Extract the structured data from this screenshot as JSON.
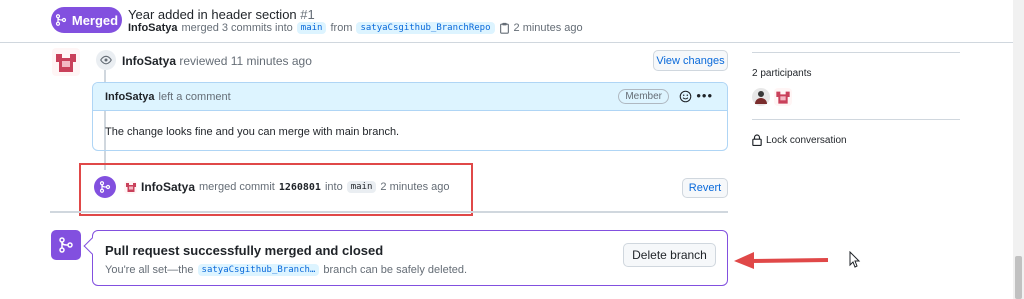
{
  "header": {
    "status_badge": "Merged",
    "title": "Year added in header section",
    "number": "#1",
    "author": "InfoSatya",
    "merged_text": "merged 3 commits into",
    "base_branch": "main",
    "from_text": "from",
    "head_branch": "satyaCsgithub_BranchRepo",
    "time": "2 minutes ago"
  },
  "review": {
    "author": "InfoSatya",
    "action": "reviewed 11 minutes ago",
    "view_changes_label": "View changes"
  },
  "comment": {
    "author": "InfoSatya",
    "action": "left a comment",
    "role_badge": "Member",
    "body": "The change looks fine and you can merge with main branch."
  },
  "merge_event": {
    "author": "InfoSatya",
    "action": "merged commit",
    "sha": "1260801",
    "into_text": "into",
    "branch": "main",
    "time": "2 minutes ago",
    "revert_label": "Revert"
  },
  "merged_panel": {
    "title": "Pull request successfully merged and closed",
    "sub_prefix": "You're all set—the",
    "branch": "satyaCsgithub_Branch…",
    "sub_suffix": "branch can be safely deleted.",
    "delete_label": "Delete branch"
  },
  "sidebar": {
    "participants_label": "2 participants",
    "lock_label": "Lock conversation"
  },
  "colors": {
    "merged_purple": "#8250df",
    "link_blue": "#0969da",
    "annotation_red": "#e04848"
  },
  "icons": [
    "git-merge-icon",
    "eye-icon",
    "clipboard-icon",
    "smiley-icon",
    "kebab-icon",
    "lock-icon",
    "avatar-icon",
    "cursor-icon"
  ]
}
